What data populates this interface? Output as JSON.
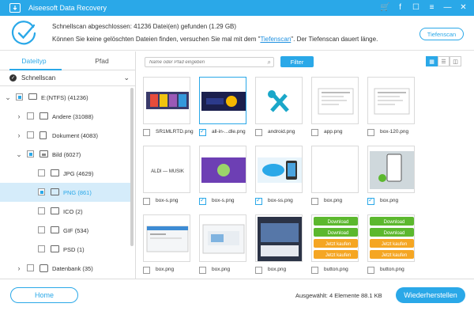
{
  "app": {
    "title": "Aiseesoft Data Recovery"
  },
  "titlebar_icons": [
    "cart-icon",
    "facebook-icon",
    "chat-icon",
    "menu-icon",
    "minimize-icon",
    "close-icon"
  ],
  "titlebar_glyphs": [
    "🛒",
    "f",
    "☐",
    "≡",
    "—",
    "✕"
  ],
  "header": {
    "line1": "Schnellscan abgeschlossen: 41236 Datei(en) gefunden (1.29 GB)",
    "line2_pre": "Können Sie keine gelöschten Dateien finden, versuchen Sie mal mit dem \"",
    "line2_link": "Tiefenscan",
    "line2_post": "\". Der Tiefenscan dauert länge.",
    "deepscan_button": "Tiefenscan"
  },
  "sidebar": {
    "tabs": [
      "Dateityp",
      "Pfad"
    ],
    "scan_mode": "Schnellscan",
    "tree": [
      {
        "label": "E:(NTFS) (41236)",
        "level": 0,
        "expanded": true,
        "check": "partial",
        "icon": "drive-icon"
      },
      {
        "label": "Andere (31088)",
        "level": 1,
        "expanded": false,
        "check": "none",
        "icon": "folder-icon"
      },
      {
        "label": "Dokument (4083)",
        "level": 1,
        "expanded": false,
        "check": "none",
        "icon": "document-icon"
      },
      {
        "label": "Bild (6027)",
        "level": 1,
        "expanded": true,
        "check": "partial",
        "icon": "image-icon"
      },
      {
        "label": "JPG (4629)",
        "level": 2,
        "check": "none",
        "icon": "folder-icon"
      },
      {
        "label": "PNG (861)",
        "level": 2,
        "check": "partial",
        "icon": "folder-icon",
        "selected": true
      },
      {
        "label": "ICO (2)",
        "level": 2,
        "check": "none",
        "icon": "folder-icon"
      },
      {
        "label": "GIF (534)",
        "level": 2,
        "check": "none",
        "icon": "folder-icon"
      },
      {
        "label": "PSD (1)",
        "level": 2,
        "check": "none",
        "icon": "folder-icon"
      },
      {
        "label": "Datenbank (35)",
        "level": 1,
        "expanded": false,
        "check": "none",
        "icon": "database-icon"
      }
    ]
  },
  "toolbar": {
    "search_placeholder": "Name oder Pfad eingeben",
    "filter_button": "Filter"
  },
  "files": [
    {
      "name": "SR1MLRTD.png",
      "checked": false,
      "thumb": "collage"
    },
    {
      "name": "all-in-...dle.png",
      "checked": true,
      "thumb": "dark-clock",
      "selected": true
    },
    {
      "name": "android.png",
      "checked": false,
      "thumb": "tools"
    },
    {
      "name": "app.png",
      "checked": false,
      "thumb": "doc"
    },
    {
      "name": "box-120.png",
      "checked": false,
      "thumb": "doc"
    },
    {
      "name": "box-s.png",
      "checked": false,
      "thumb": "logo"
    },
    {
      "name": "box-s.png",
      "checked": true,
      "thumb": "android-purple"
    },
    {
      "name": "box-ss.png",
      "checked": true,
      "thumb": "cloud-phone"
    },
    {
      "name": "box.png",
      "checked": false,
      "thumb": "blank"
    },
    {
      "name": "box.png",
      "checked": true,
      "thumb": "phone-hand"
    },
    {
      "name": "box.png",
      "checked": false,
      "thumb": "screen"
    },
    {
      "name": "box.png",
      "checked": false,
      "thumb": "screen2"
    },
    {
      "name": "box.png",
      "checked": false,
      "thumb": "screen3"
    },
    {
      "name": "button.png",
      "checked": false,
      "thumb": "buttons"
    },
    {
      "name": "button.png",
      "checked": false,
      "thumb": "buttons"
    }
  ],
  "thumb_text": {
    "logo": "ALDI — MUSIK",
    "download": "Download",
    "buy_now": "Jetzt kaufen"
  },
  "footer": {
    "home_button": "Home",
    "selected_info": "Ausgewählt: 4 Elemente 88.1 KB",
    "recover_button": "Wiederherstellen"
  },
  "colors": {
    "accent": "#2aa8e8",
    "selection": "#d5ecfa",
    "green": "#5cb82e",
    "orange": "#f5a623"
  }
}
